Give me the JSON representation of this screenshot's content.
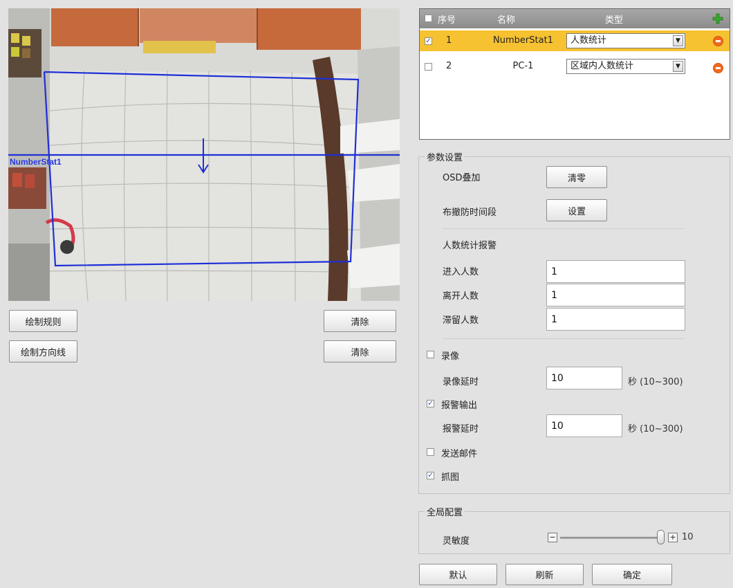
{
  "video": {
    "rule_label": "NumberStat1",
    "overlay_color": "#1e2fd6"
  },
  "left_buttons": {
    "draw_rule": "绘制规则",
    "clear_rule": "清除",
    "draw_direction": "绘制方向线",
    "clear_direction": "清除"
  },
  "rules_table": {
    "headers": {
      "index": "序号",
      "name": "名称",
      "type": "类型"
    },
    "add_icon": "plus-icon",
    "rows": [
      {
        "index": "1",
        "name": "NumberStat1",
        "type": "人数统计",
        "checked": true,
        "selected": true
      },
      {
        "index": "2",
        "name": "PC-1",
        "type": "区域内人数统计",
        "checked": false,
        "selected": false
      }
    ]
  },
  "params": {
    "legend": "参数设置",
    "osd_label": "OSD叠加",
    "osd_button": "清零",
    "schedule_label": "布撤防时间段",
    "schedule_button": "设置",
    "alarm_title": "人数统计报警",
    "enter_label": "进入人数",
    "enter_value": "1",
    "leave_label": "离开人数",
    "leave_value": "1",
    "stay_label": "滞留人数",
    "stay_value": "1",
    "record_label": "录像",
    "record_checked": false,
    "record_delay_label": "录像延时",
    "record_delay_value": "10",
    "record_delay_hint": "秒 (10~300)",
    "alarm_out_label": "报警输出",
    "alarm_out_checked": true,
    "alarm_delay_label": "报警延时",
    "alarm_delay_value": "10",
    "alarm_delay_hint": "秒 (10~300)",
    "email_label": "发送邮件",
    "email_checked": false,
    "snapshot_label": "抓图",
    "snapshot_checked": true
  },
  "global": {
    "legend": "全局配置",
    "sensitivity_label": "灵敏度",
    "sensitivity_value": "10",
    "sensitivity_fraction": 1.0
  },
  "footer": {
    "default": "默认",
    "refresh": "刷新",
    "confirm": "确定"
  },
  "colors": {
    "selected_row": "#f6c231",
    "remove": "#ef6b1d",
    "add": "#3aa630"
  }
}
